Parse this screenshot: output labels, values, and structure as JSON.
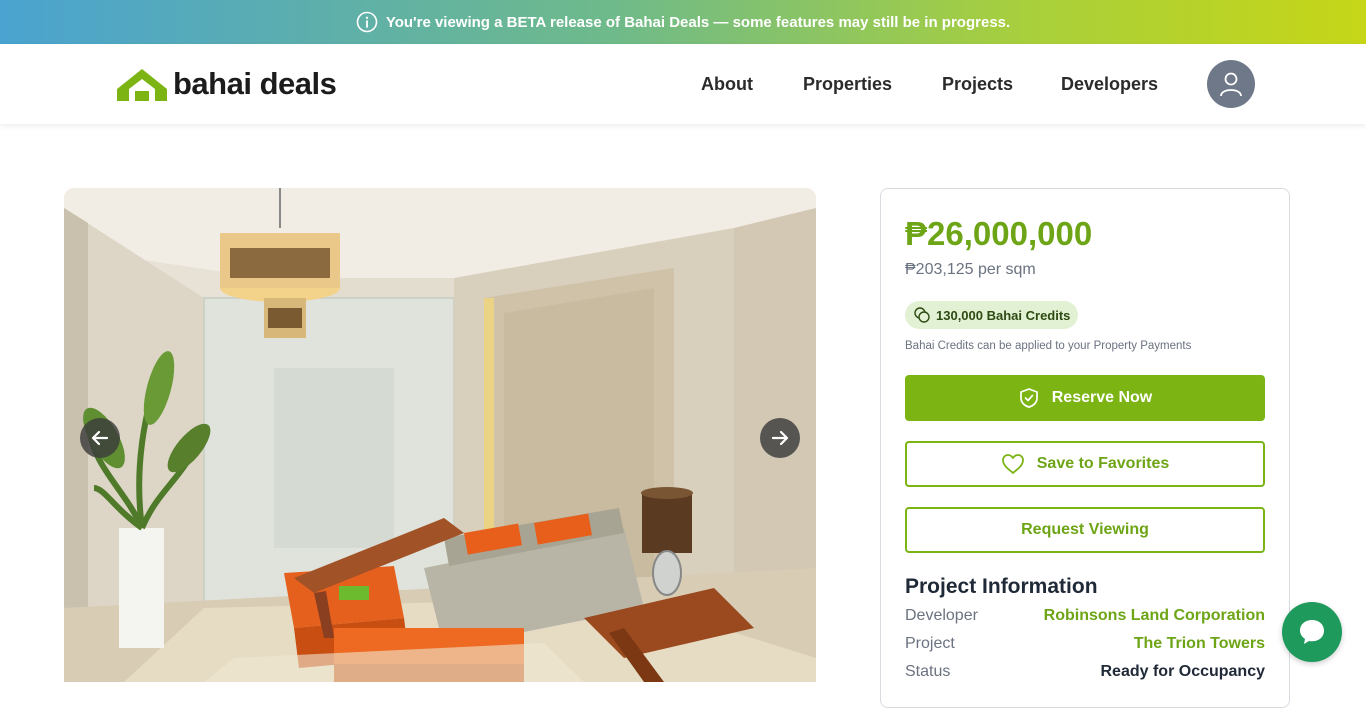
{
  "banner": {
    "icon": "info-icon",
    "text": "You're viewing a BETA release of Bahai Deals — some features may still be in progress."
  },
  "header": {
    "logo_text": "bahai deals",
    "nav": [
      "About",
      "Properties",
      "Projects",
      "Developers"
    ],
    "avatar_icon": "user-icon"
  },
  "gallery": {
    "prev_icon": "arrow-left-icon",
    "next_icon": "arrow-right-icon"
  },
  "listing": {
    "price": "₱26,000,000",
    "price_per_sqm": "₱203,125 per sqm",
    "credits_badge": "130,000 Bahai Credits",
    "credits_note": "Bahai Credits can be applied to your Property Payments",
    "reserve_label": "Reserve Now",
    "favorite_label": "Save to Favorites",
    "viewing_label": "Request Viewing",
    "project_info_title": "Project Information",
    "project_info": [
      {
        "label": "Developer",
        "value": "Robinsons Land Corporation"
      },
      {
        "label": "Project",
        "value": "The Trion Towers"
      },
      {
        "label": "Status",
        "value": "Ready for Occupancy"
      }
    ]
  },
  "colors": {
    "accent": "#7cb414",
    "accent_text": "#6ea516",
    "chat": "#1e9b5c"
  }
}
